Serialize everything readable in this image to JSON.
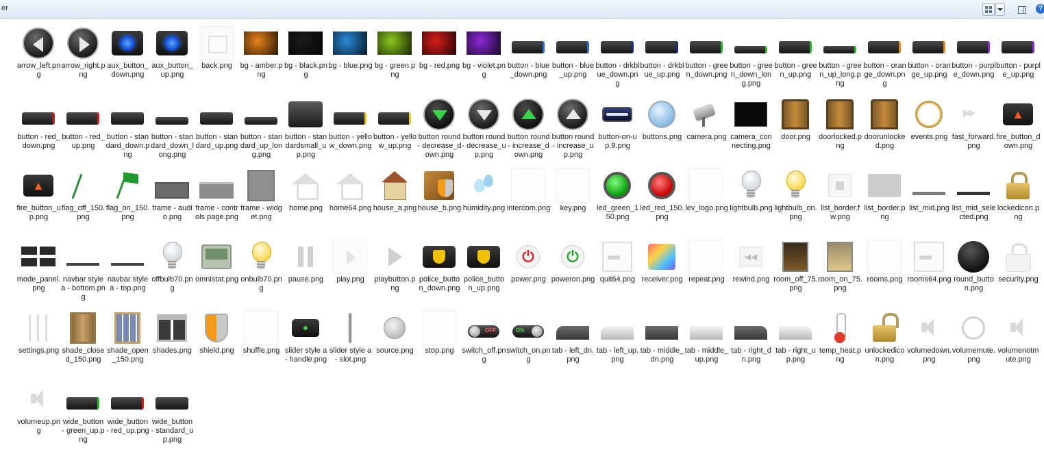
{
  "window": {
    "title_fragment": "er"
  },
  "toolbar": {
    "view_label": "",
    "help_label": "?"
  },
  "files": [
    {
      "name": "arrow_left.png",
      "icon": "arrow-left-circle"
    },
    {
      "name": "arrow_right.png",
      "icon": "arrow-right-circle"
    },
    {
      "name": "aux_button_down.png",
      "icon": "aux-button"
    },
    {
      "name": "aux_button_up.png",
      "icon": "aux-button"
    },
    {
      "name": "back.png",
      "icon": "back-arrow-ghost"
    },
    {
      "name": "bg - amber.png",
      "icon": "bg-swatch",
      "color": "#e8841c"
    },
    {
      "name": "bg - black.png",
      "icon": "bg-swatch",
      "color": "#1a1a1a"
    },
    {
      "name": "bg - blue.png",
      "icon": "bg-swatch",
      "color": "#2a8ad8"
    },
    {
      "name": "bg - green.png",
      "icon": "bg-swatch",
      "color": "#8ac81c"
    },
    {
      "name": "bg - red.png",
      "icon": "bg-swatch",
      "color": "#d81c1c"
    },
    {
      "name": "bg - violet.png",
      "icon": "bg-swatch",
      "color": "#8a2ad8"
    },
    {
      "name": "button - blue_down.png",
      "icon": "button-bar",
      "color": "#2a6ad8"
    },
    {
      "name": "button - blue_up.png",
      "icon": "button-bar",
      "color": "#2a6ad8"
    },
    {
      "name": "button - drkblue_down.png",
      "icon": "button-bar",
      "color": "#1a2a8a"
    },
    {
      "name": "button - drkblue_up.png",
      "icon": "button-bar",
      "color": "#1a2a8a"
    },
    {
      "name": "button - green_down.png",
      "icon": "button-bar",
      "color": "#2ab82a"
    },
    {
      "name": "button - green_down_long.png",
      "icon": "button-bar-long",
      "color": "#2ab82a"
    },
    {
      "name": "button - green_up.png",
      "icon": "button-bar",
      "color": "#2ab82a"
    },
    {
      "name": "button - green_up_long.png",
      "icon": "button-bar-long",
      "color": "#2ab82a"
    },
    {
      "name": "button - orange_down.png",
      "icon": "button-bar",
      "color": "#e8841c"
    },
    {
      "name": "button - orange_up.png",
      "icon": "button-bar",
      "color": "#e8841c"
    },
    {
      "name": "button - purple_down.png",
      "icon": "button-bar",
      "color": "#8a2ad8"
    },
    {
      "name": "button - purple_up.png",
      "icon": "button-bar",
      "color": "#8a2ad8"
    },
    {
      "name": "button - red_down.png",
      "icon": "button-bar",
      "color": "#d81c1c"
    },
    {
      "name": "button - red_up.png",
      "icon": "button-bar",
      "color": "#d81c1c"
    },
    {
      "name": "button - standard_down.png",
      "icon": "button-bar-std",
      "color": "#2a2a2a"
    },
    {
      "name": "button - standard_down_long.png",
      "icon": "button-bar-long-std",
      "color": "#2a2a2a"
    },
    {
      "name": "button - standard_up.png",
      "icon": "button-bar-std",
      "color": "#2a2a2a"
    },
    {
      "name": "button - standard_up_long.png",
      "icon": "button-bar-long-std",
      "color": "#2a2a2a"
    },
    {
      "name": "button - standardsmall_up.png",
      "icon": "button-big"
    },
    {
      "name": "button - yellow_down.png",
      "icon": "button-bar",
      "color": "#e8c81c"
    },
    {
      "name": "button - yellow_up.png",
      "icon": "button-bar",
      "color": "#e8c81c"
    },
    {
      "name": "button round - decrease_down.png",
      "icon": "round-decrease-green"
    },
    {
      "name": "button round - decrease_up.png",
      "icon": "round-decrease"
    },
    {
      "name": "button round - increase_down.png",
      "icon": "round-increase-green"
    },
    {
      "name": "button round - increase_up.png",
      "icon": "round-increase"
    },
    {
      "name": "button-on-up.9.png",
      "icon": "button-on-up"
    },
    {
      "name": "buttons.png",
      "icon": "buttons-gear"
    },
    {
      "name": "camera.png",
      "icon": "camera"
    },
    {
      "name": "camera_connecting.png",
      "icon": "camera-connecting"
    },
    {
      "name": "door.png",
      "icon": "door"
    },
    {
      "name": "doorlocked.png",
      "icon": "door"
    },
    {
      "name": "doorunlocked.png",
      "icon": "door"
    },
    {
      "name": "events.png",
      "icon": "clock"
    },
    {
      "name": "fast_forward.png",
      "icon": "fast-forward"
    },
    {
      "name": "fire_button_down.png",
      "icon": "fire-button"
    },
    {
      "name": "fire_button_up.png",
      "icon": "fire-button"
    },
    {
      "name": "flag_off_150.png",
      "icon": "flag-off"
    },
    {
      "name": "flag_on_150.png",
      "icon": "flag-on"
    },
    {
      "name": "frame - audio.png",
      "icon": "frame-gray"
    },
    {
      "name": "frame - controls page.png",
      "icon": "frame-light"
    },
    {
      "name": "frame - widget.png",
      "icon": "frame-widget"
    },
    {
      "name": "home.png",
      "icon": "home-ghost"
    },
    {
      "name": "home64.png",
      "icon": "home-ghost"
    },
    {
      "name": "house_a.png",
      "icon": "house"
    },
    {
      "name": "house_b.png",
      "icon": "house-shield"
    },
    {
      "name": "humidity.png",
      "icon": "humidity"
    },
    {
      "name": "intercom.png",
      "icon": "blank"
    },
    {
      "name": "key.png",
      "icon": "blank"
    },
    {
      "name": "led_green_150.png",
      "icon": "led-green"
    },
    {
      "name": "led_red_150.png",
      "icon": "led-red"
    },
    {
      "name": "lev_logo.png",
      "icon": "blank"
    },
    {
      "name": "lightbulb.png",
      "icon": "bulb-off"
    },
    {
      "name": "lightbulb_on.png",
      "icon": "bulb-on"
    },
    {
      "name": "list_border.fw.png",
      "icon": "list-box"
    },
    {
      "name": "list_border.png",
      "icon": "list-big"
    },
    {
      "name": "list_mid.png",
      "icon": "list-mid"
    },
    {
      "name": "list_mid_selected.png",
      "icon": "list-mid-selected"
    },
    {
      "name": "lockedicon.png",
      "icon": "lock"
    },
    {
      "name": "mode_panel.png",
      "icon": "mode-panel"
    },
    {
      "name": "navbar style a - bottom.png",
      "icon": "navbar"
    },
    {
      "name": "navbar style a - top.png",
      "icon": "navbar"
    },
    {
      "name": "offbulb70.png",
      "icon": "bulb-off"
    },
    {
      "name": "omnistat.png",
      "icon": "thermostat"
    },
    {
      "name": "onbulb70.png",
      "icon": "bulb-on"
    },
    {
      "name": "pause.png",
      "icon": "pause"
    },
    {
      "name": "play.png",
      "icon": "play-ghost"
    },
    {
      "name": "playbutton.png",
      "icon": "play-button"
    },
    {
      "name": "police_button_down.png",
      "icon": "police-button"
    },
    {
      "name": "police_button_up.png",
      "icon": "police-button"
    },
    {
      "name": "power.png",
      "icon": "power-red"
    },
    {
      "name": "poweron.png",
      "icon": "power-green"
    },
    {
      "name": "quit64.png",
      "icon": "quit"
    },
    {
      "name": "receiver.png",
      "icon": "receiver"
    },
    {
      "name": "repeat.png",
      "icon": "blank"
    },
    {
      "name": "rewind.png",
      "icon": "rewind"
    },
    {
      "name": "room_off_75.png",
      "icon": "room-off"
    },
    {
      "name": "room_on_75.png",
      "icon": "room-on"
    },
    {
      "name": "rooms.png",
      "icon": "blank"
    },
    {
      "name": "rooms64.png",
      "icon": "quit"
    },
    {
      "name": "round_button.png",
      "icon": "round-black"
    },
    {
      "name": "security.png",
      "icon": "lock-ghost"
    },
    {
      "name": "settings.png",
      "icon": "settings"
    },
    {
      "name": "shade_closed_150.png",
      "icon": "shade-closed"
    },
    {
      "name": "shade_open_150.png",
      "icon": "shade-open"
    },
    {
      "name": "shades.png",
      "icon": "shades"
    },
    {
      "name": "shield.png",
      "icon": "shield"
    },
    {
      "name": "shuffle.png",
      "icon": "blank"
    },
    {
      "name": "slider style a - handle.png",
      "icon": "slider-handle"
    },
    {
      "name": "slider style a - slot.png",
      "icon": "slider-slot"
    },
    {
      "name": "source.png",
      "icon": "source"
    },
    {
      "name": "stop.png",
      "icon": "blank"
    },
    {
      "name": "switch_off.png",
      "icon": "switch-off",
      "text": "OFF"
    },
    {
      "name": "switch_on.png",
      "icon": "switch-on",
      "text": "ON"
    },
    {
      "name": "tab - left_dn.png",
      "icon": "tab-left-dn"
    },
    {
      "name": "tab - left_up.png",
      "icon": "tab-left-up"
    },
    {
      "name": "tab - middle_dn.png",
      "icon": "tab-middle-dn"
    },
    {
      "name": "tab - middle_up.png",
      "icon": "tab-middle-up"
    },
    {
      "name": "tab - right_dn.png",
      "icon": "tab-right-dn"
    },
    {
      "name": "tab - right_up.png",
      "icon": "tab-right-up"
    },
    {
      "name": "temp_heat.png",
      "icon": "thermometer"
    },
    {
      "name": "unlockedicon.png",
      "icon": "lock-open"
    },
    {
      "name": "volumedown.png",
      "icon": "volume"
    },
    {
      "name": "volumemute.png",
      "icon": "volume-mute"
    },
    {
      "name": "volumenotmute.png",
      "icon": "volume"
    },
    {
      "name": "volumeup.png",
      "icon": "volume"
    },
    {
      "name": "wide_button - green_up.png",
      "icon": "button-bar",
      "color": "#2ab82a"
    },
    {
      "name": "wide_button - red_up.png",
      "icon": "button-bar",
      "color": "#d81c1c"
    },
    {
      "name": "wide_button - standard_up.png",
      "icon": "button-bar-std",
      "color": "#2a2a2a"
    }
  ]
}
